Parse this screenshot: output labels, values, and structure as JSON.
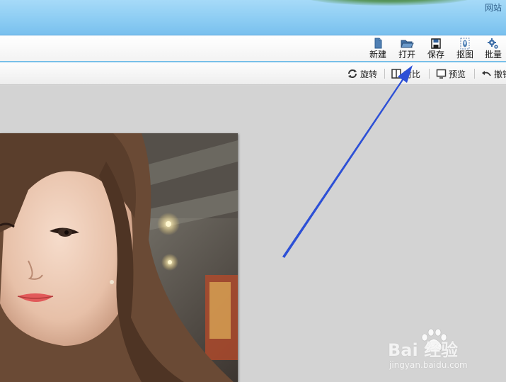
{
  "titlebar": {
    "site_link": "网站"
  },
  "toolbar": {
    "items": [
      {
        "label": "新建",
        "icon": "new-file-icon"
      },
      {
        "label": "打开",
        "icon": "open-folder-icon"
      },
      {
        "label": "保存",
        "icon": "save-icon"
      },
      {
        "label": "抠图",
        "icon": "cutout-icon"
      },
      {
        "label": "批量",
        "icon": "batch-gears-icon"
      }
    ]
  },
  "subbar": {
    "items": [
      {
        "label": "旋转",
        "icon": "rotate-icon"
      },
      {
        "label": "对比",
        "icon": "compare-icon"
      },
      {
        "label": "预览",
        "icon": "preview-icon"
      },
      {
        "label": "撤销",
        "icon": "undo-icon"
      }
    ]
  },
  "watermark": {
    "brand": "Bai 经验",
    "url": "jingyan.baidu.com"
  },
  "colors": {
    "accent": "#2d50d6",
    "titlebar": "#8dcdf3",
    "toolbar_border": "#78bfe8"
  }
}
